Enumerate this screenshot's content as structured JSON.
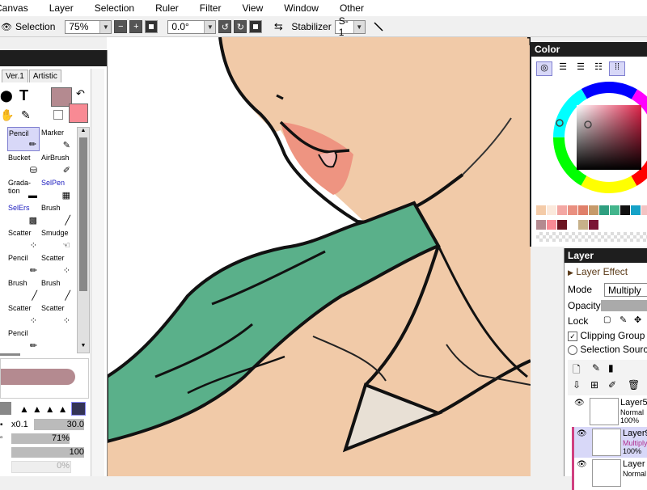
{
  "menu": [
    "Canvas",
    "Layer",
    "Selection",
    "Ruler",
    "Filter",
    "View",
    "Window",
    "Other"
  ],
  "toolbar": {
    "selection_label": "Selection",
    "zoom": "75%",
    "rotation": "0.0°",
    "stabilizer_label": "Stabilizer",
    "stabilizer_value": "S-1"
  },
  "tool_panel": {
    "tabs": [
      "Ver.1",
      "Artistic"
    ],
    "primary_color": "#b48a90",
    "secondary_color": "#f88a94",
    "tools": [
      {
        "label": "Pencil",
        "selected": true,
        "blue": false,
        "icon": "pencil-icon"
      },
      {
        "label": "Marker",
        "selected": false,
        "blue": false,
        "icon": "marker-icon"
      },
      {
        "label": "Bucket",
        "selected": false,
        "blue": false,
        "icon": "bucket-icon"
      },
      {
        "label": "AirBrush",
        "selected": false,
        "blue": false,
        "icon": "airbrush-icon"
      },
      {
        "label": "Grada-\ntion",
        "selected": false,
        "blue": false,
        "icon": "gradation-icon"
      },
      {
        "label": "SelPen",
        "selected": false,
        "blue": true,
        "icon": "selpen-icon"
      },
      {
        "label": "SelErs",
        "selected": false,
        "blue": true,
        "icon": "selers-icon"
      },
      {
        "label": "Brush",
        "selected": false,
        "blue": false,
        "icon": "brush-icon"
      },
      {
        "label": "Scatter",
        "selected": false,
        "blue": false,
        "icon": "scatter-icon"
      },
      {
        "label": "Smudge",
        "selected": false,
        "blue": false,
        "icon": "smudge-icon"
      },
      {
        "label": "Pencil",
        "selected": false,
        "blue": false,
        "icon": "pencil-icon"
      },
      {
        "label": "Scatter",
        "selected": false,
        "blue": false,
        "icon": "scatter-icon"
      },
      {
        "label": "Brush",
        "selected": false,
        "blue": false,
        "icon": "brush-icon"
      },
      {
        "label": "Brush",
        "selected": false,
        "blue": false,
        "icon": "brush-icon"
      },
      {
        "label": "Scatter",
        "selected": false,
        "blue": false,
        "icon": "scatter-icon"
      },
      {
        "label": "Scatter",
        "selected": false,
        "blue": false,
        "icon": "scatter-icon"
      },
      {
        "label": "Pencil",
        "selected": false,
        "blue": false,
        "icon": "pencil-icon"
      }
    ],
    "size_multiplier": "x0.1",
    "size_value": "30.0",
    "density": "71%",
    "min_size": "100",
    "blend": "0%"
  },
  "color_panel": {
    "title": "Color",
    "swatches_row1": [
      "#f4cba8",
      "#fbe9dc",
      "#f3a7a3",
      "#e98f80",
      "#e0806a",
      "#c69a6a",
      "#2f9f80",
      "#43b58c",
      "#111111",
      "#16a2c7",
      "#f3c3c3"
    ],
    "swatches_row2": [
      "#b48a90",
      "#f88a94",
      "#6b1420",
      "#ffffff",
      "#c7b18a",
      "#7a1535"
    ]
  },
  "layer_panel": {
    "title": "Layer",
    "effect_label": "Layer Effect",
    "mode_label": "Mode",
    "mode_value": "Multiply",
    "opacity_label": "Opacity",
    "lock_label": "Lock",
    "clipping_label": "Clipping Group",
    "selection_source_label": "Selection Source",
    "layers": [
      {
        "name": "Layer5",
        "mode": "Normal",
        "opacity": "100%",
        "selected": false
      },
      {
        "name": "Layer9",
        "mode": "Multiply",
        "opacity": "100%",
        "selected": true
      },
      {
        "name": "Layer",
        "mode": "Normal",
        "opacity": "",
        "selected": false
      }
    ]
  },
  "colors": {
    "skin": "#f1caa8",
    "scarf": "#5ab08a",
    "blush": "#ee9481",
    "collar": "#e8e0d5",
    "line": "#111111"
  }
}
